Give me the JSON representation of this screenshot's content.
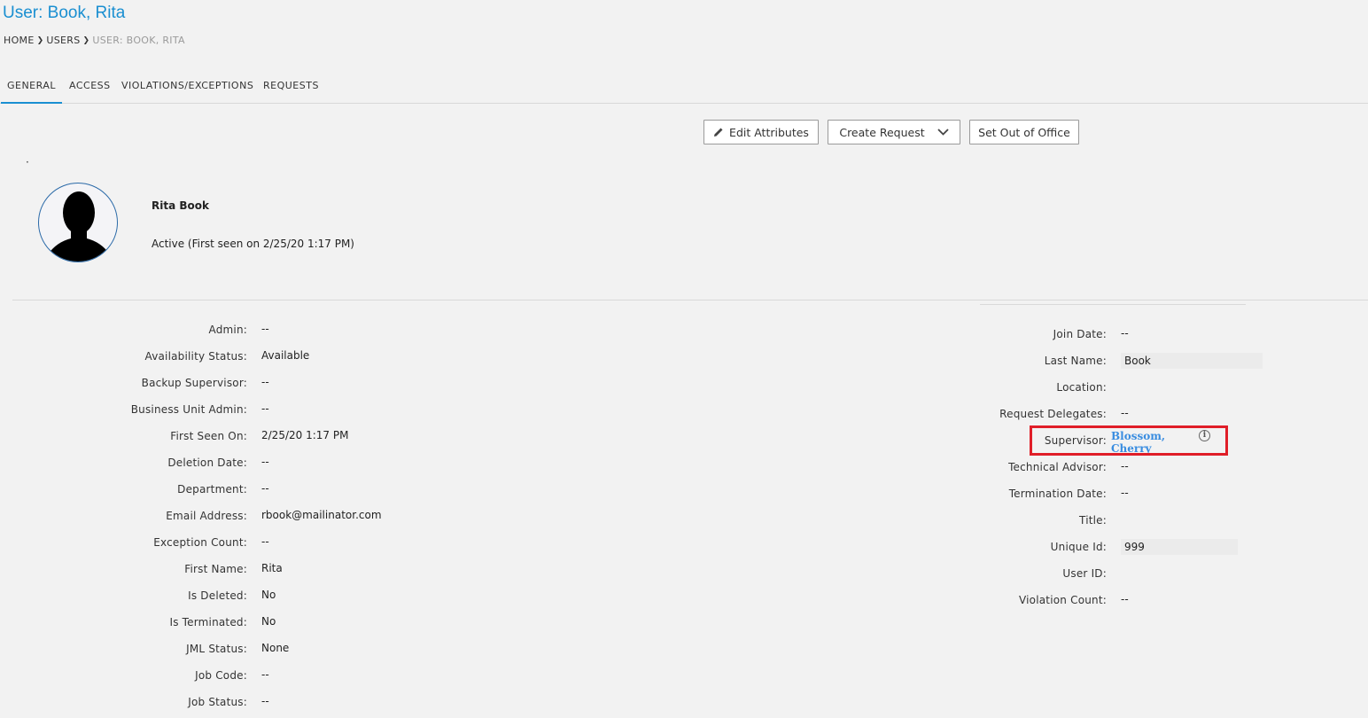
{
  "header": {
    "title": "User: Book, Rita",
    "breadcrumb": [
      "HOME",
      "USERS",
      "USER: BOOK, RITA"
    ]
  },
  "tabs": [
    "GENERAL",
    "ACCESS",
    "VIOLATIONS/EXCEPTIONS",
    "REQUESTS"
  ],
  "actions": {
    "edit_attributes": "Edit Attributes",
    "create_request": "Create Request",
    "set_out_of_office": "Set Out of Office"
  },
  "profile": {
    "name": "Rita Book",
    "status": "Active (First seen on 2/25/20 1:17 PM)"
  },
  "left_attributes": [
    {
      "label": "Admin:",
      "value": "--"
    },
    {
      "label": "Availability Status:",
      "value": "Available"
    },
    {
      "label": "Backup Supervisor:",
      "value": "--"
    },
    {
      "label": "Business Unit Admin:",
      "value": "--"
    },
    {
      "label": "First Seen On:",
      "value": "2/25/20 1:17 PM"
    },
    {
      "label": "Deletion Date:",
      "value": "--"
    },
    {
      "label": "Department:",
      "value": "--"
    },
    {
      "label": "Email Address:",
      "value": "rbook@mailinator.com"
    },
    {
      "label": "Exception Count:",
      "value": "--"
    },
    {
      "label": "First Name:",
      "value": "Rita"
    },
    {
      "label": "Is Deleted:",
      "value": "No"
    },
    {
      "label": "Is Terminated:",
      "value": "No"
    },
    {
      "label": "JML Status:",
      "value": "None"
    },
    {
      "label": "Job Code:",
      "value": "--"
    },
    {
      "label": "Job Status:",
      "value": "--"
    }
  ],
  "right_attributes": [
    {
      "label": "Join Date:",
      "value": "--"
    },
    {
      "label": "Last Name:",
      "value": "Book"
    },
    {
      "label": "Location:",
      "value": ""
    },
    {
      "label": "Request Delegates:",
      "value": "--"
    },
    {
      "label": "Supervisor:",
      "value": "Blossom, Cherry"
    },
    {
      "label": "Technical Advisor:",
      "value": "--"
    },
    {
      "label": "Termination Date:",
      "value": "--"
    },
    {
      "label": "Title:",
      "value": ""
    },
    {
      "label": "Unique Id:",
      "value": "999"
    },
    {
      "label": "User ID:",
      "value": ""
    },
    {
      "label": "Violation Count:",
      "value": "--"
    }
  ],
  "icons": {
    "edit": "pencil-icon",
    "dropdown": "chevron-down-icon",
    "info": "info-icon",
    "avatar": "user-silhouette-icon"
  },
  "colors": {
    "accent": "#1a8fd1",
    "link": "#3a8de0",
    "highlight_border": "#e01e28"
  }
}
